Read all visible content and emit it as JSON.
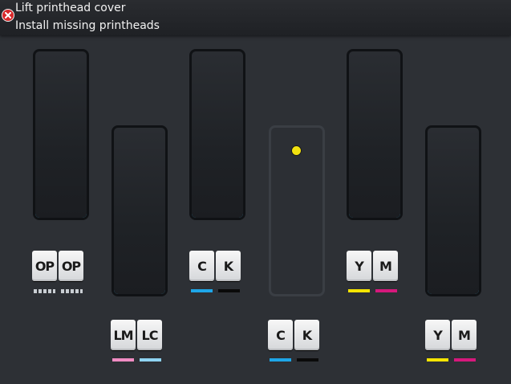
{
  "header": {
    "line1": "Lift printhead cover",
    "line2": "Install missing printheads"
  },
  "colors": {
    "cyan": "#1ea6e8",
    "black": "#0a0a0a",
    "yellow": "#f5e400",
    "magenta": "#d6187c",
    "light_magenta": "#f08cc3",
    "light_cyan": "#8fd4f2",
    "outline_active": "#46b9e6",
    "missing_indicator": "#f2e20f"
  },
  "slots": [
    {
      "id": "op",
      "labels": [
        "OP",
        "OP"
      ],
      "installed": true
    },
    {
      "id": "lm-lc",
      "labels": [
        "LM",
        "LC"
      ],
      "installed": true
    },
    {
      "id": "c-k-1",
      "labels": [
        "C",
        "K"
      ],
      "installed": true
    },
    {
      "id": "c-k-2",
      "labels": [
        "C",
        "K"
      ],
      "installed": false
    },
    {
      "id": "y-m-1",
      "labels": [
        "Y",
        "M"
      ],
      "installed": true
    },
    {
      "id": "y-m-2",
      "labels": [
        "Y",
        "M"
      ],
      "installed": true
    }
  ]
}
